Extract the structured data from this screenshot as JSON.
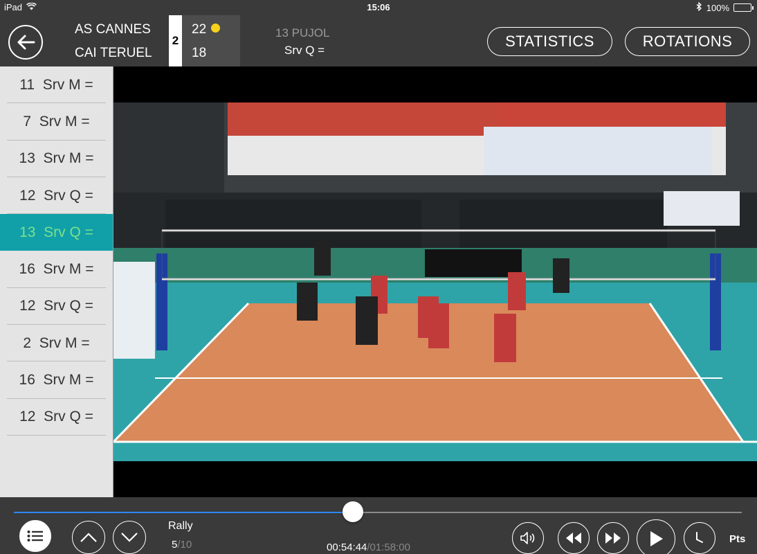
{
  "status_bar": {
    "device": "iPad",
    "time": "15:06",
    "battery": "100%",
    "battery_level": 1.0
  },
  "header": {
    "teams": [
      {
        "name": "AS CANNES",
        "score": "22",
        "serving": true
      },
      {
        "name": "CAI TERUEL",
        "score": "18",
        "serving": false
      }
    ],
    "set_number": "2",
    "current_player": "13 PUJOL",
    "current_action": "Srv Q =",
    "statistics_label": "STATISTICS",
    "rotations_label": "ROTATIONS"
  },
  "actions": [
    {
      "label": "11  Srv M =",
      "active": false
    },
    {
      "label": "7  Srv M =",
      "active": false
    },
    {
      "label": "13  Srv M =",
      "active": false
    },
    {
      "label": "12  Srv Q =",
      "active": false
    },
    {
      "label": "13  Srv Q =",
      "active": true
    },
    {
      "label": "16  Srv M =",
      "active": false
    },
    {
      "label": "12  Srv Q =",
      "active": false
    },
    {
      "label": "2  Srv M =",
      "active": false
    },
    {
      "label": "16  Srv M =",
      "active": false
    },
    {
      "label": "12  Srv Q =",
      "active": false
    }
  ],
  "player": {
    "progress_fraction": 0.466,
    "rally_label": "Rally",
    "rally_current": "5",
    "rally_total": "/10",
    "elapsed": "00:54:44",
    "duration": "/01:58:00",
    "pts_label": "Pts"
  },
  "colors": {
    "accent_teal": "#11a0a8",
    "active_text": "#7de08a",
    "progress": "#2f86ff",
    "serve_indicator": "#f5d21b"
  }
}
